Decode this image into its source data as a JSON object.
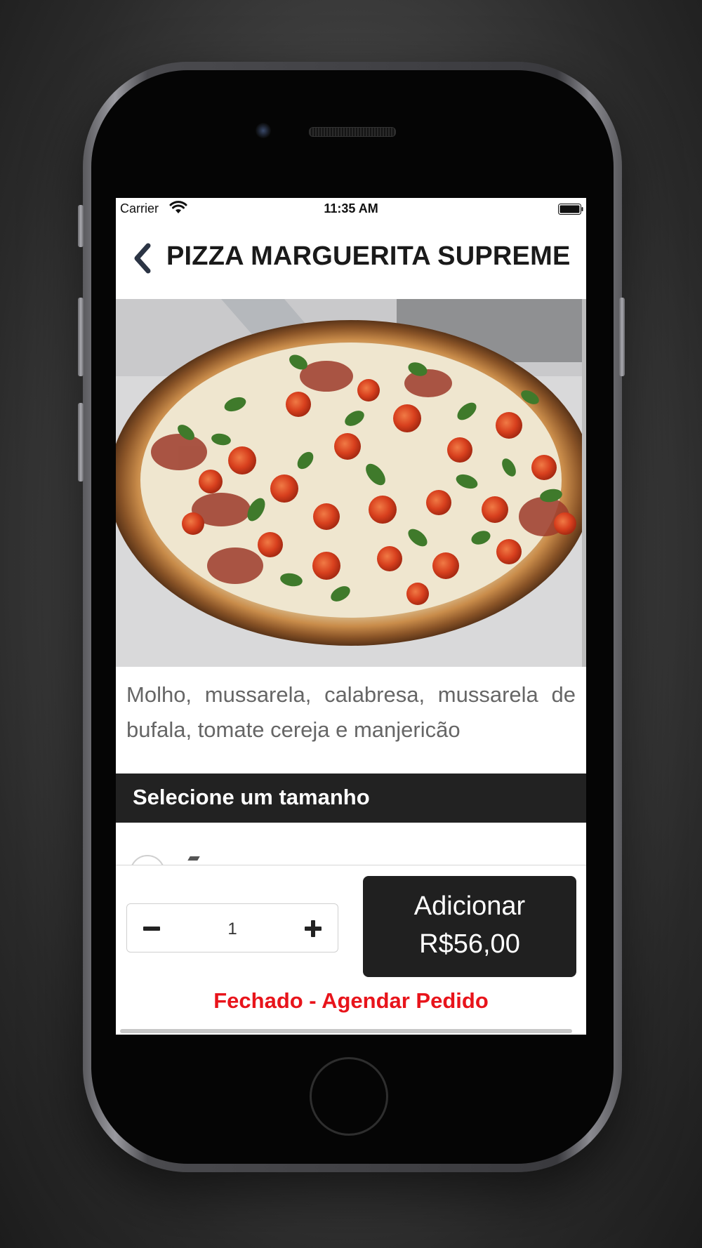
{
  "status_bar": {
    "carrier": "Carrier",
    "time": "11:35 AM"
  },
  "header": {
    "title": "PIZZA MARGUERITA SUPREME"
  },
  "product": {
    "description": "Molho, mussarela, calabresa, mussarela de bufala, tomate cereja e manjericão"
  },
  "size_section": {
    "title": "Selecione um tamanho"
  },
  "order": {
    "quantity": "1",
    "add_label": "Adicionar",
    "add_price": "R$56,00",
    "closed_notice": "Fechado - Agendar Pedido"
  },
  "colors": {
    "dark": "#202020",
    "alert_red": "#e8141b",
    "background": "#ffffff"
  },
  "icons": [
    "wifi-icon",
    "battery-icon",
    "back-chevron-icon",
    "minus-icon",
    "plus-icon"
  ]
}
